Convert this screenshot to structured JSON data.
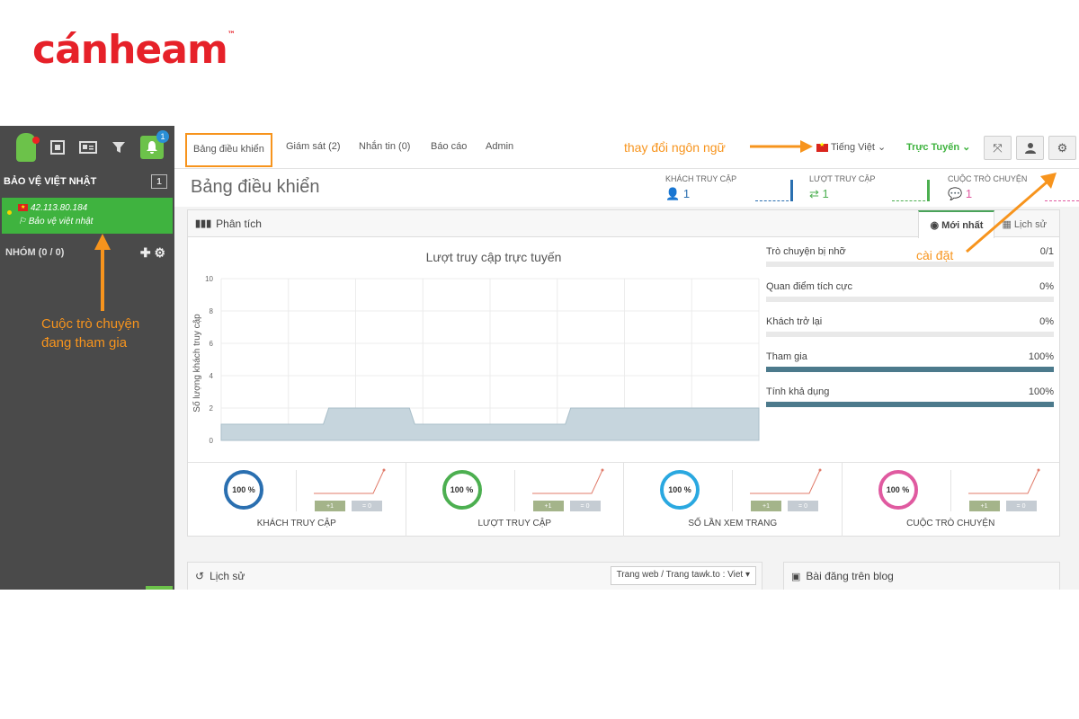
{
  "logo": {
    "text": "cánheam",
    "tm": "™"
  },
  "sidebar": {
    "notif_count": "1",
    "section_title": "BẢO VỆ VIỆT NHẬT",
    "section_count": "1",
    "visitor": {
      "ip": "42.113.80.184",
      "name": "Bảo vệ việt nhật"
    },
    "group_label": "NHÓM (0 / 0)",
    "annotation_line1": "Cuộc trò chuyện",
    "annotation_line2": "đang tham gia"
  },
  "nav": {
    "tabs": [
      "Bảng điều khiển",
      "Giám sát (2)",
      "Nhắn tin (0)",
      "Báo cáo",
      "Admin"
    ],
    "lang_annotation": "thay đổi ngôn ngữ",
    "language": "Tiếng Việt",
    "status": "Trực Tuyến"
  },
  "header": {
    "title": "Bảng điều khiển",
    "stats": [
      {
        "label": "KHÁCH TRUY CẬP",
        "value": "1",
        "color": "#2a6fb0"
      },
      {
        "label": "LƯỢT TRUY CẬP",
        "value": "1",
        "color": "#4caf50"
      },
      {
        "label": "CUỘC TRÒ CHUYỆN",
        "value": "1",
        "color": "#e05aa0"
      }
    ]
  },
  "analytics": {
    "title": "Phân tích",
    "tab_latest": "Mới nhất",
    "tab_history": "Lịch sử",
    "settings_annotation": "cài đặt",
    "metrics": [
      {
        "label": "Trò chuyện bị nhỡ",
        "value": "0/1",
        "fill": 0
      },
      {
        "label": "Quan điểm tích cực",
        "value": "0%",
        "fill": 0
      },
      {
        "label": "Khách trở lại",
        "value": "0%",
        "fill": 0
      },
      {
        "label": "Tham gia",
        "value": "100%",
        "fill": 1
      },
      {
        "label": "Tính khả dụng",
        "value": "100%",
        "fill": 1
      }
    ],
    "kpis": [
      {
        "label": "Khách truy cập",
        "percent": "100 %",
        "color": "#2a6fb0",
        "plus": "+1",
        "equal": "= 0"
      },
      {
        "label": "Lượt truy cập",
        "percent": "100 %",
        "color": "#4caf50",
        "plus": "+1",
        "equal": "= 0"
      },
      {
        "label": "Số lần xem trang",
        "percent": "100 %",
        "color": "#2aa8e0",
        "plus": "+1",
        "equal": "= 0"
      },
      {
        "label": "Cuộc trò chuyện",
        "percent": "100 %",
        "color": "#e05aa0",
        "plus": "+1",
        "equal": "= 0"
      }
    ]
  },
  "chart_data": {
    "type": "area",
    "title": "Lượt truy cập trực tuyến",
    "xlabel": "",
    "ylabel": "Số lượng khách truy cập",
    "ylim": [
      0,
      10
    ],
    "yticks": [
      "0",
      "2",
      "4",
      "6",
      "8",
      "10"
    ],
    "x": [
      0,
      19,
      20,
      35,
      36,
      64,
      65,
      100
    ],
    "values": [
      1,
      1,
      2,
      2,
      1,
      1,
      2,
      2
    ],
    "fill_color": "#c6d5dd"
  },
  "bottom": {
    "history_title": "Lịch sử",
    "history_select": "Trang web / Trang tawk.to : Viet",
    "blog_title": "Bài đăng trên blog"
  }
}
